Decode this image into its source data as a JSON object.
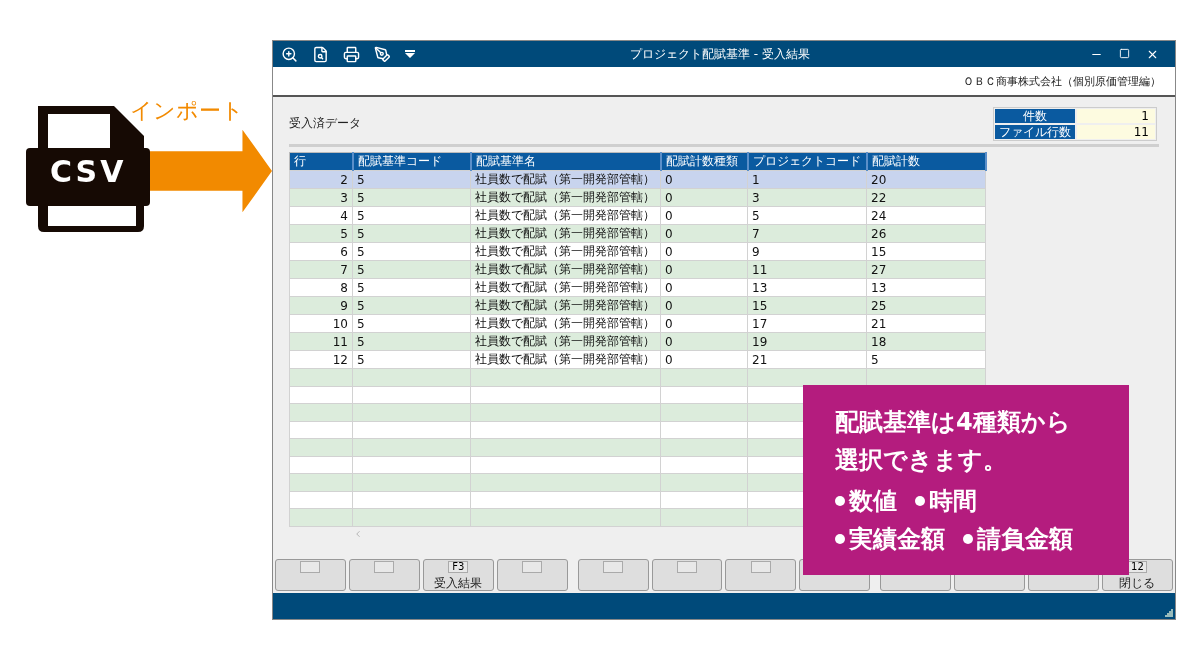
{
  "import_label": "インポート",
  "csv_icon": {
    "label": "CSV"
  },
  "window": {
    "title": "プロジェクト配賦基準 - 受入結果",
    "company": "ＯＢＣ商事株式会社（個別原価管理編）"
  },
  "section_label": "受入済データ",
  "summary": [
    {
      "label": "件数",
      "value": "1"
    },
    {
      "label": "ファイル行数",
      "value": "11"
    }
  ],
  "table": {
    "columns": [
      "行",
      "配賦基準コード",
      "配賦基準名",
      "配賦計数種類",
      "プロジェクトコード",
      "配賦計数"
    ],
    "rows": [
      {
        "cells": [
          "2",
          "5",
          "社員数で配賦（第一開発部管轄）",
          "0",
          "1",
          "20"
        ],
        "selected": true
      },
      {
        "cells": [
          "3",
          "5",
          "社員数で配賦（第一開発部管轄）",
          "0",
          "3",
          "22"
        ],
        "selected": false
      },
      {
        "cells": [
          "4",
          "5",
          "社員数で配賦（第一開発部管轄）",
          "0",
          "5",
          "24"
        ],
        "selected": false
      },
      {
        "cells": [
          "5",
          "5",
          "社員数で配賦（第一開発部管轄）",
          "0",
          "7",
          "26"
        ],
        "selected": false
      },
      {
        "cells": [
          "6",
          "5",
          "社員数で配賦（第一開発部管轄）",
          "0",
          "9",
          "15"
        ],
        "selected": false
      },
      {
        "cells": [
          "7",
          "5",
          "社員数で配賦（第一開発部管轄）",
          "0",
          "11",
          "27"
        ],
        "selected": false
      },
      {
        "cells": [
          "8",
          "5",
          "社員数で配賦（第一開発部管轄）",
          "0",
          "13",
          "13"
        ],
        "selected": false
      },
      {
        "cells": [
          "9",
          "5",
          "社員数で配賦（第一開発部管轄）",
          "0",
          "15",
          "25"
        ],
        "selected": false
      },
      {
        "cells": [
          "10",
          "5",
          "社員数で配賦（第一開発部管轄）",
          "0",
          "17",
          "21"
        ],
        "selected": false
      },
      {
        "cells": [
          "11",
          "5",
          "社員数で配賦（第一開発部管轄）",
          "0",
          "19",
          "18"
        ],
        "selected": false
      },
      {
        "cells": [
          "12",
          "5",
          "社員数で配賦（第一開発部管轄）",
          "0",
          "21",
          "5"
        ],
        "selected": false
      }
    ]
  },
  "function_keys": [
    {
      "kind": "blank"
    },
    {
      "kind": "blank"
    },
    {
      "kind": "labeled",
      "key": "F3",
      "label": "受入結果"
    },
    {
      "kind": "blank"
    },
    {
      "kind": "blank"
    },
    {
      "kind": "blank"
    },
    {
      "kind": "blank"
    },
    {
      "kind": "blank"
    },
    {
      "kind": "blank"
    },
    {
      "kind": "blank"
    },
    {
      "kind": "blank"
    },
    {
      "kind": "labeled",
      "key": "12",
      "label": "閉じる"
    }
  ],
  "callout": {
    "text": "配賦基準は4種類から選択できます。",
    "bullets": [
      [
        "数値",
        "時間"
      ],
      [
        "実績金額",
        "請負金額"
      ]
    ]
  }
}
